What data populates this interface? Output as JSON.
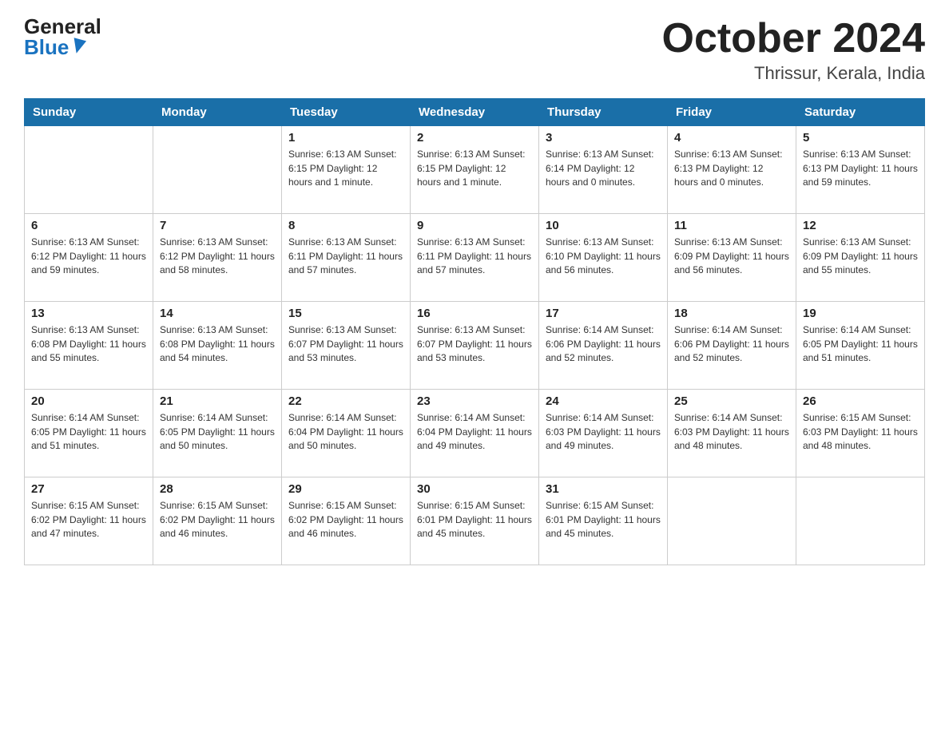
{
  "header": {
    "logo_general": "General",
    "logo_blue": "Blue",
    "month_title": "October 2024",
    "location": "Thrissur, Kerala, India"
  },
  "weekdays": [
    "Sunday",
    "Monday",
    "Tuesday",
    "Wednesday",
    "Thursday",
    "Friday",
    "Saturday"
  ],
  "weeks": [
    [
      {
        "day": "",
        "info": ""
      },
      {
        "day": "",
        "info": ""
      },
      {
        "day": "1",
        "info": "Sunrise: 6:13 AM\nSunset: 6:15 PM\nDaylight: 12 hours\nand 1 minute."
      },
      {
        "day": "2",
        "info": "Sunrise: 6:13 AM\nSunset: 6:15 PM\nDaylight: 12 hours\nand 1 minute."
      },
      {
        "day": "3",
        "info": "Sunrise: 6:13 AM\nSunset: 6:14 PM\nDaylight: 12 hours\nand 0 minutes."
      },
      {
        "day": "4",
        "info": "Sunrise: 6:13 AM\nSunset: 6:13 PM\nDaylight: 12 hours\nand 0 minutes."
      },
      {
        "day": "5",
        "info": "Sunrise: 6:13 AM\nSunset: 6:13 PM\nDaylight: 11 hours\nand 59 minutes."
      }
    ],
    [
      {
        "day": "6",
        "info": "Sunrise: 6:13 AM\nSunset: 6:12 PM\nDaylight: 11 hours\nand 59 minutes."
      },
      {
        "day": "7",
        "info": "Sunrise: 6:13 AM\nSunset: 6:12 PM\nDaylight: 11 hours\nand 58 minutes."
      },
      {
        "day": "8",
        "info": "Sunrise: 6:13 AM\nSunset: 6:11 PM\nDaylight: 11 hours\nand 57 minutes."
      },
      {
        "day": "9",
        "info": "Sunrise: 6:13 AM\nSunset: 6:11 PM\nDaylight: 11 hours\nand 57 minutes."
      },
      {
        "day": "10",
        "info": "Sunrise: 6:13 AM\nSunset: 6:10 PM\nDaylight: 11 hours\nand 56 minutes."
      },
      {
        "day": "11",
        "info": "Sunrise: 6:13 AM\nSunset: 6:09 PM\nDaylight: 11 hours\nand 56 minutes."
      },
      {
        "day": "12",
        "info": "Sunrise: 6:13 AM\nSunset: 6:09 PM\nDaylight: 11 hours\nand 55 minutes."
      }
    ],
    [
      {
        "day": "13",
        "info": "Sunrise: 6:13 AM\nSunset: 6:08 PM\nDaylight: 11 hours\nand 55 minutes."
      },
      {
        "day": "14",
        "info": "Sunrise: 6:13 AM\nSunset: 6:08 PM\nDaylight: 11 hours\nand 54 minutes."
      },
      {
        "day": "15",
        "info": "Sunrise: 6:13 AM\nSunset: 6:07 PM\nDaylight: 11 hours\nand 53 minutes."
      },
      {
        "day": "16",
        "info": "Sunrise: 6:13 AM\nSunset: 6:07 PM\nDaylight: 11 hours\nand 53 minutes."
      },
      {
        "day": "17",
        "info": "Sunrise: 6:14 AM\nSunset: 6:06 PM\nDaylight: 11 hours\nand 52 minutes."
      },
      {
        "day": "18",
        "info": "Sunrise: 6:14 AM\nSunset: 6:06 PM\nDaylight: 11 hours\nand 52 minutes."
      },
      {
        "day": "19",
        "info": "Sunrise: 6:14 AM\nSunset: 6:05 PM\nDaylight: 11 hours\nand 51 minutes."
      }
    ],
    [
      {
        "day": "20",
        "info": "Sunrise: 6:14 AM\nSunset: 6:05 PM\nDaylight: 11 hours\nand 51 minutes."
      },
      {
        "day": "21",
        "info": "Sunrise: 6:14 AM\nSunset: 6:05 PM\nDaylight: 11 hours\nand 50 minutes."
      },
      {
        "day": "22",
        "info": "Sunrise: 6:14 AM\nSunset: 6:04 PM\nDaylight: 11 hours\nand 50 minutes."
      },
      {
        "day": "23",
        "info": "Sunrise: 6:14 AM\nSunset: 6:04 PM\nDaylight: 11 hours\nand 49 minutes."
      },
      {
        "day": "24",
        "info": "Sunrise: 6:14 AM\nSunset: 6:03 PM\nDaylight: 11 hours\nand 49 minutes."
      },
      {
        "day": "25",
        "info": "Sunrise: 6:14 AM\nSunset: 6:03 PM\nDaylight: 11 hours\nand 48 minutes."
      },
      {
        "day": "26",
        "info": "Sunrise: 6:15 AM\nSunset: 6:03 PM\nDaylight: 11 hours\nand 48 minutes."
      }
    ],
    [
      {
        "day": "27",
        "info": "Sunrise: 6:15 AM\nSunset: 6:02 PM\nDaylight: 11 hours\nand 47 minutes."
      },
      {
        "day": "28",
        "info": "Sunrise: 6:15 AM\nSunset: 6:02 PM\nDaylight: 11 hours\nand 46 minutes."
      },
      {
        "day": "29",
        "info": "Sunrise: 6:15 AM\nSunset: 6:02 PM\nDaylight: 11 hours\nand 46 minutes."
      },
      {
        "day": "30",
        "info": "Sunrise: 6:15 AM\nSunset: 6:01 PM\nDaylight: 11 hours\nand 45 minutes."
      },
      {
        "day": "31",
        "info": "Sunrise: 6:15 AM\nSunset: 6:01 PM\nDaylight: 11 hours\nand 45 minutes."
      },
      {
        "day": "",
        "info": ""
      },
      {
        "day": "",
        "info": ""
      }
    ]
  ]
}
